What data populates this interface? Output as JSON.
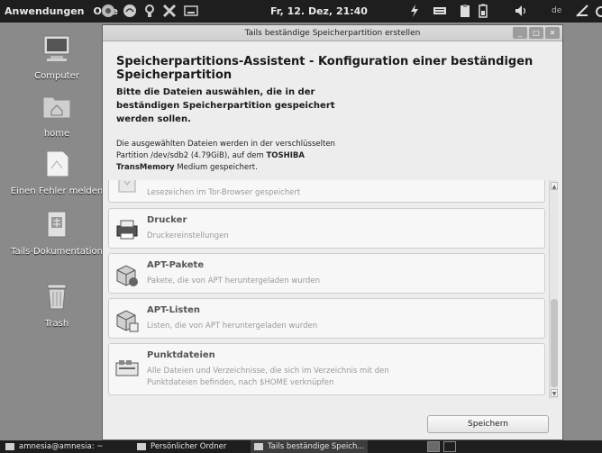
{
  "top_panel": {
    "menu_apps": "Anwendungen",
    "menu_places": "Orte",
    "clock": "Fr, 12. Dez, 21:40",
    "language": "de"
  },
  "desktop": {
    "icons": [
      {
        "label": "Computer",
        "icon": "computer-icon"
      },
      {
        "label": "home",
        "icon": "home-folder-icon"
      },
      {
        "label": "Einen Fehler melden",
        "icon": "bug-report-icon"
      },
      {
        "label": "Tails-Dokumentation",
        "icon": "documentation-icon"
      },
      {
        "label": "Trash",
        "icon": "trash-icon"
      }
    ]
  },
  "window": {
    "title": "Tails beständige Speicherpartition erstellen",
    "heading": "Speicherpartitions-Assistent - Konfiguration einer beständigen Speicherpartition",
    "intro": "Bitte die Dateien auswählen, die in der beständigen Speicherpartition gespeichert werden sollen.",
    "desc_prefix": "Die ausgewählten Dateien werden in der verschlüsselten Partition /dev/sdb2 (4.79GiB), auf dem",
    "desc_device": "TOSHIBA TransMemory",
    "desc_suffix": "Medium gespeichert.",
    "items": [
      {
        "name": "",
        "sub": "Lesezeichen im Tor-Browser gespeichert",
        "icon": "bookmark-icon"
      },
      {
        "name": "Drucker",
        "sub": "Druckereinstellungen",
        "icon": "printer-icon"
      },
      {
        "name": "APT-Pakete",
        "sub": "Pakete, die von APT heruntergeladen wurden",
        "icon": "package-icon"
      },
      {
        "name": "APT-Listen",
        "sub": "Listen, die von APT heruntergeladen wurden",
        "icon": "package-list-icon"
      },
      {
        "name": "Punktdateien",
        "sub": "Alle Dateien und Verzeichnisse, die sich im Verzeichnis mit den Punktdateien befinden, nach $HOME verknüpfen",
        "icon": "dotfiles-icon"
      }
    ],
    "save_label": "Speichern"
  },
  "taskbar": {
    "items": [
      {
        "label": "amnesia@amnesia: ~"
      },
      {
        "label": "Persönlicher Ordner"
      },
      {
        "label": "Tails beständige Speich..."
      }
    ]
  }
}
